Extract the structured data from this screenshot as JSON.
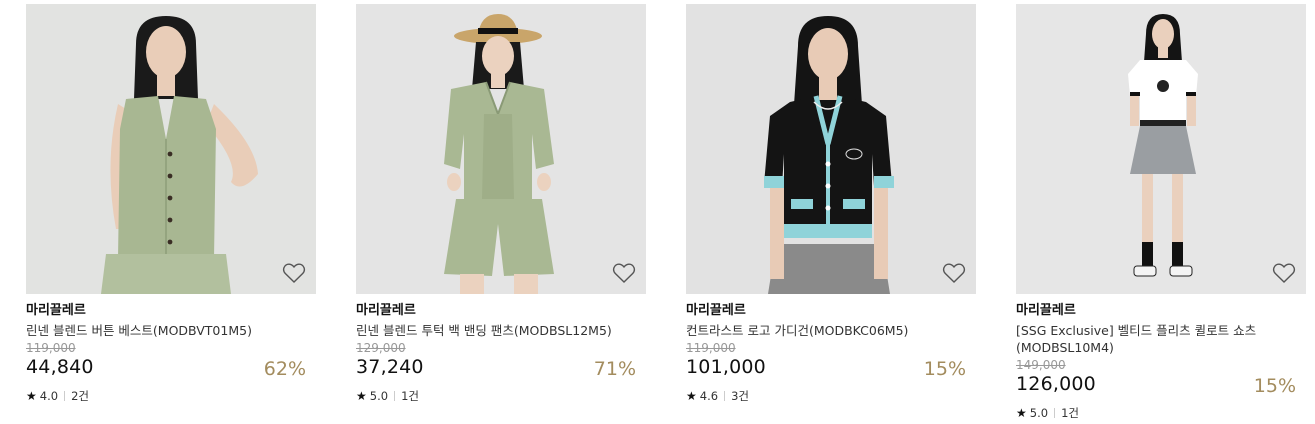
{
  "products": [
    {
      "brand": "마리끌레르",
      "name": "린넨 블렌드 버튼 베스트(MODBVT01M5)",
      "original_price": "119,000",
      "sale_price": "44,840",
      "discount": "62%",
      "rating": "4.0",
      "review_count": "2건",
      "colors": {
        "bg": "#e2e3e1",
        "garment": "#a8b792",
        "skin": "#e9cdb8",
        "hair": "#1a1a1a"
      }
    },
    {
      "brand": "마리끌레르",
      "name": "린넨 블렌드 투턱 백 밴딩 팬츠(MODBSL12M5)",
      "original_price": "129,000",
      "sale_price": "37,240",
      "discount": "71%",
      "rating": "5.0",
      "review_count": "1건",
      "colors": {
        "bg": "#e4e4e4",
        "garment": "#a9b893",
        "skin": "#ebd2bf",
        "hair": "#1a1a1a",
        "hat": "#c9a56a"
      }
    },
    {
      "brand": "마리끌레르",
      "name": "컨트라스트 로고 가디건(MODBKC06M5)",
      "original_price": "119,000",
      "sale_price": "101,000",
      "discount": "15%",
      "rating": "4.6",
      "review_count": "3건",
      "colors": {
        "bg": "#e2e2e2",
        "garment": "#141414",
        "trim": "#8fd3d9",
        "skirt": "#8a8a8a",
        "skin": "#e8cbb6",
        "hair": "#141414"
      }
    },
    {
      "brand": "마리끌레르",
      "name": "[SSG Exclusive] 벨티드 플리츠 퀼로트 쇼츠(MODBSL10M4)",
      "original_price": "149,000",
      "sale_price": "126,000",
      "discount": "15%",
      "rating": "5.0",
      "review_count": "1건",
      "colors": {
        "bg": "#e6e6e6",
        "garment": "#ffffff",
        "skirt": "#9a9ea2",
        "skin": "#ead0bd",
        "hair": "#141414",
        "sock": "#111111"
      }
    }
  ],
  "icons": {
    "wishlist": "heart-outline-icon",
    "rating": "star-icon"
  },
  "accent_discount_color": "#a38c5e"
}
